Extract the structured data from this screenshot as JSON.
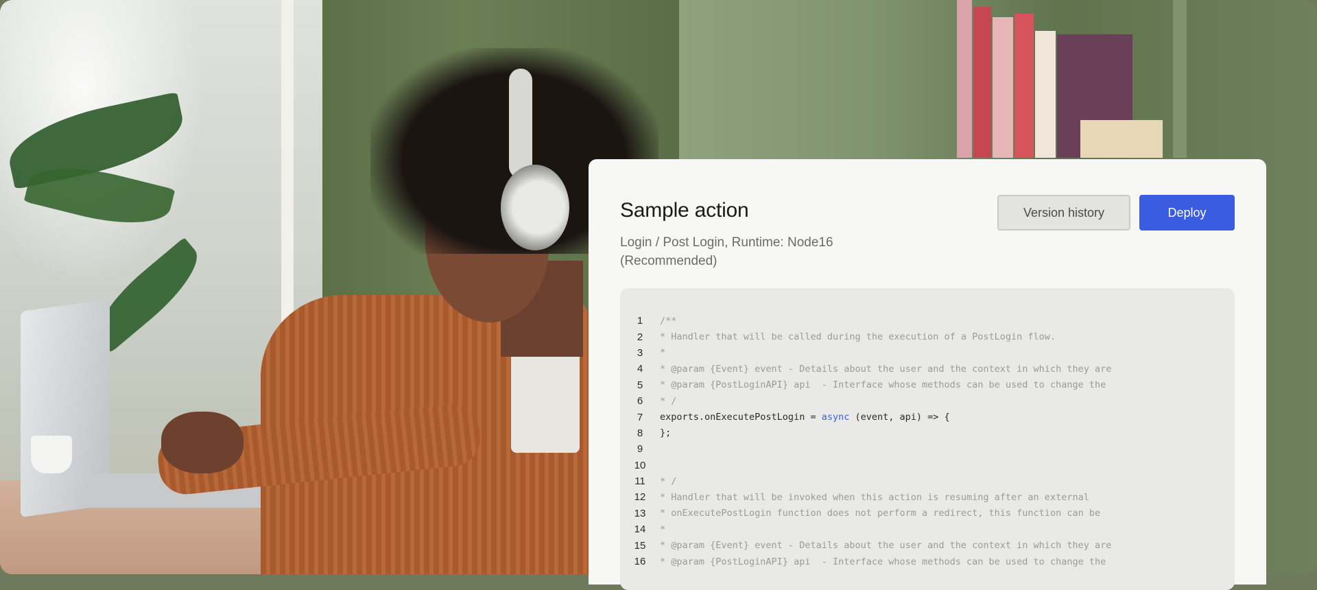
{
  "card": {
    "title": "Sample action",
    "subtitle_line1": "Login / Post Login, Runtime: Node16",
    "subtitle_line2": "(Recommended)",
    "buttons": {
      "version_history": "Version history",
      "deploy": "Deploy"
    },
    "colors": {
      "accent": "#3c5ce0",
      "card_bg": "#f7f7f5",
      "code_bg": "#e9e9e8"
    }
  },
  "code": {
    "lines": [
      {
        "n": "1",
        "text": "/**",
        "comment": true
      },
      {
        "n": "2",
        "text": "* Handler that will be called during the execution of a PostLogin flow.",
        "comment": true
      },
      {
        "n": "3",
        "text": "*",
        "comment": true
      },
      {
        "n": "4",
        "text": "* @param {Event} event - Details about the user and the context in which they are",
        "comment": true
      },
      {
        "n": "5",
        "text": "* @param {PostLoginAPI} api  - Interface whose methods can be used to change the",
        "comment": true
      },
      {
        "n": "6",
        "text": "* /",
        "comment": true
      },
      {
        "n": "7",
        "pre": "exports.onExecutePostLogin = ",
        "kw": "async",
        "post": " (event, api) => {",
        "comment": false
      },
      {
        "n": "8",
        "text": "};",
        "comment": false
      },
      {
        "n": "9",
        "text": "",
        "comment": false
      },
      {
        "n": "10",
        "text": "",
        "comment": false
      },
      {
        "n": "11",
        "text": "* /",
        "comment": true
      },
      {
        "n": "12",
        "text": "* Handler that will be invoked when this action is resuming after an external",
        "comment": true
      },
      {
        "n": "13",
        "text": "* onExecutePostLogin function does not perform a redirect, this function can be",
        "comment": true
      },
      {
        "n": "14",
        "text": "*",
        "comment": true
      },
      {
        "n": "15",
        "text": "* @param {Event} event - Details about the user and the context in which they are",
        "comment": true
      },
      {
        "n": "16",
        "text": "* @param {PostLoginAPI} api  - Interface whose methods can be used to change the",
        "comment": true
      }
    ]
  }
}
